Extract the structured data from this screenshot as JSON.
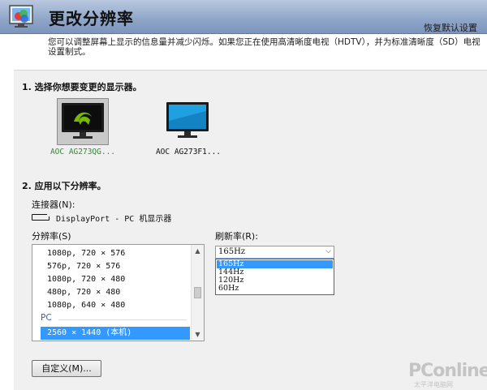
{
  "header": {
    "title": "更改分辨率",
    "restore_link": "恢复默认设置"
  },
  "description": "您可以调整屏幕上显示的信息量并减少闪烁。如果您正在使用高清晰度电视（HDTV），并为标准清晰度（SD）电视设置制式。",
  "section1": {
    "heading": "1. 选择你想要变更的显示器。",
    "displays": [
      {
        "label": "AOC AG273QG...",
        "selected": true
      },
      {
        "label": "AOC AG273F1...",
        "selected": false
      }
    ]
  },
  "section2": {
    "heading": "2. 应用以下分辨率。",
    "connector_label": "连接器(N):",
    "connector_value": "DisplayPort - PC 机显示器",
    "resolution_label": "分辨率(S)",
    "resolutions": [
      "1080p, 720 × 576",
      "576p, 720 × 576",
      "1080p, 720 × 480",
      "480p, 720 × 480",
      "1080p, 640 × 480"
    ],
    "group_label": "PC",
    "selected_resolution": "2560 × 1440 (本机)",
    "refresh_label": "刷新率(R):",
    "refresh_selected": "165Hz",
    "refresh_options": [
      "165Hz",
      "144Hz",
      "120Hz",
      "60Hz"
    ],
    "custom_button": "自定义(M)..."
  },
  "watermark": {
    "brand": "PConline",
    "sub": "太平洋电脑网"
  },
  "colors": {
    "accent": "#3399ff",
    "header": "#8ea5c8",
    "selected_display_label": "#2f8a2f"
  }
}
